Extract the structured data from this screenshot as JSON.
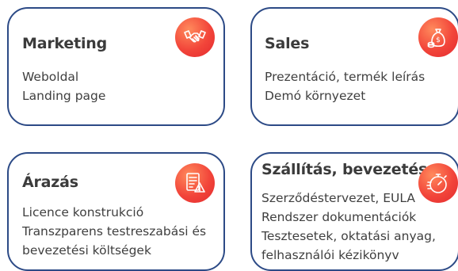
{
  "accent_color": "#e8392f",
  "border_color": "#2c4a86",
  "cards": [
    {
      "title": "Marketing",
      "icon": "handshake-icon",
      "lines": [
        "Weboldal",
        "Landing page"
      ]
    },
    {
      "title": "Sales",
      "icon": "money-bag-icon",
      "lines": [
        "Prezentáció, termék leírás",
        "Demó környezet"
      ]
    },
    {
      "title": "Árazás",
      "icon": "price-list-warning-icon",
      "lines": [
        "Licence konstrukció",
        "Transzparens testreszabási és",
        "bevezetési költségek"
      ]
    },
    {
      "title": "Szállítás, bevezetés",
      "icon": "stopwatch-icon",
      "lines": [
        "Szerződéstervezet, EULA",
        "Rendszer dokumentációk",
        "Tesztesetek, oktatási anyag,",
        "felhasználói kézikönyv"
      ]
    }
  ]
}
